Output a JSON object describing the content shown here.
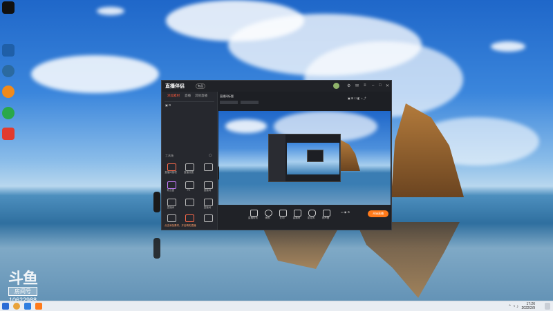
{
  "desktop": {
    "icons": [
      {
        "name": "tiktok-icon",
        "label": "",
        "color": "#111111"
      },
      {
        "name": "app-icon-2",
        "label": "",
        "color": "#1f5fa8"
      },
      {
        "name": "app-icon-3",
        "label": "",
        "color": "#2b6aa0"
      },
      {
        "name": "app-icon-4",
        "label": "",
        "color": "#f08a1c"
      },
      {
        "name": "app-icon-5",
        "label": "",
        "color": "#2aa84a"
      },
      {
        "name": "wps-icon",
        "label": "",
        "color": "#e23b2e"
      }
    ]
  },
  "watermark": {
    "logo": "斗鱼",
    "badge": "房间号",
    "room": "10622988"
  },
  "app": {
    "brand": "直播伴侣",
    "brand_tag": "有品",
    "left_tabs": [
      "添加素材",
      "直播",
      "其他直播"
    ],
    "source_label": "工具箱",
    "tools": [
      {
        "label": "直播间管理"
      },
      {
        "label": "直播设置"
      },
      {
        "label": ""
      },
      {
        "label": "粉丝团"
      },
      {
        "label": "PK"
      },
      {
        "label": "直播间"
      },
      {
        "label": "直播间"
      },
      {
        "label": ""
      },
      {
        "label": "直播间"
      }
    ],
    "bottom_notice": "点击添加素材，开启精彩直播",
    "header_title": "直播间标题",
    "bottom_tools": [
      {
        "label": "直播特效"
      },
      {
        "label": "美颜"
      },
      {
        "label": "互动"
      },
      {
        "label": "直播间"
      },
      {
        "label": "麦克风"
      },
      {
        "label": "扬声器"
      }
    ],
    "start_label": "开始直播"
  },
  "taskbar": {
    "time": "17:26",
    "date": "2022/2/9"
  }
}
